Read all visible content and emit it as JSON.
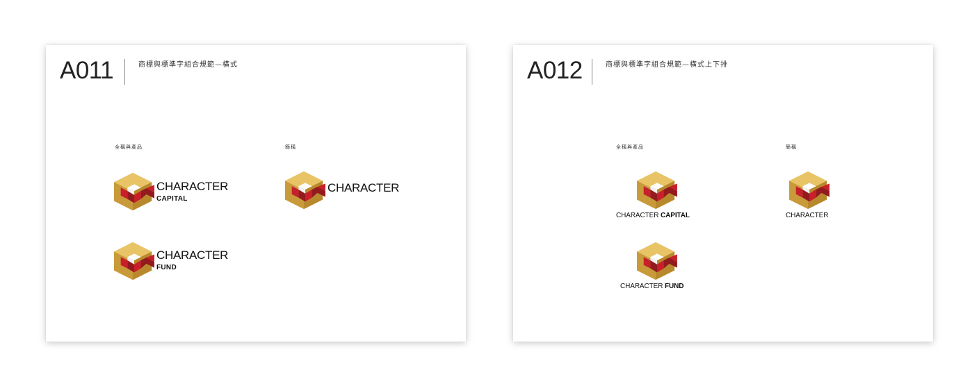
{
  "cards": [
    {
      "code": "A011",
      "subtitle": "商標與標準字組合規範—橫式",
      "label_full": "全稱與產品",
      "label_short": "簡稱",
      "lockups": [
        {
          "main": "CHARACTER",
          "sub": "CAPITAL"
        },
        {
          "main": "CHARACTER",
          "sub": ""
        },
        {
          "main": "CHARACTER",
          "sub": "FUND"
        }
      ]
    },
    {
      "code": "A012",
      "subtitle": "商標與標準字組合規範—橫式上下排",
      "label_full": "全稱與產品",
      "label_short": "簡稱",
      "lockups": [
        {
          "main": "CHARACTER",
          "sub": "CAPITAL"
        },
        {
          "main": "CHARACTER",
          "sub": ""
        },
        {
          "main": "CHARACTER",
          "sub": "FUND"
        }
      ]
    }
  ],
  "colors": {
    "gold_light": "#E8C466",
    "gold": "#D4A94A",
    "gold_dark": "#B8892C",
    "red": "#C8202A",
    "red_dark": "#931A1F"
  },
  "icons": [
    "character-logo-icon"
  ]
}
